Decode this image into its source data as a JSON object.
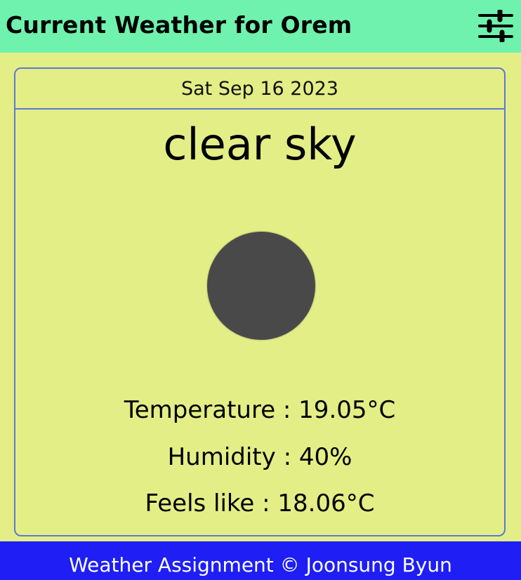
{
  "header": {
    "title": "Current Weather for Orem",
    "settings_icon": "sliders-icon"
  },
  "weather": {
    "date": "Sat Sep 16 2023",
    "condition": "clear sky",
    "icon": "clear-sky-icon",
    "temperature": "Temperature : 19.05°C",
    "humidity": "Humidity : 40%",
    "feels_like": "Feels like : 18.06°C"
  },
  "footer": {
    "text": "Weather Assignment © Joonsung Byun"
  },
  "colors": {
    "header_bg": "#6ff2ad",
    "page_bg": "#e3ee86",
    "card_border": "#5b78d6",
    "footer_bg": "#1e1ef5",
    "icon_fill": "#4a494a"
  }
}
